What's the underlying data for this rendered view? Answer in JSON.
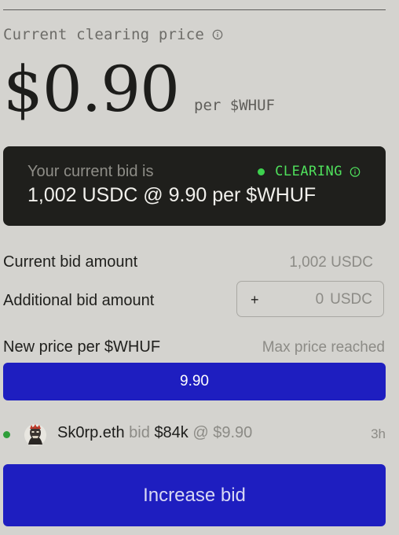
{
  "header": {
    "clearing_price_label": "Current clearing price",
    "clearing_price_value": "$0.90",
    "clearing_price_unit": "per $WHUF"
  },
  "current_bid_card": {
    "label": "Your current bid is",
    "value": "1,002 USDC @ 9.90 per $WHUF",
    "status": "CLEARING",
    "status_color": "#4fe05c"
  },
  "form": {
    "current_bid_label": "Current bid amount",
    "current_bid_value": "1,002 USDC",
    "additional_bid_label": "Additional bid amount",
    "additional_bid_prefix": "+",
    "additional_bid_value": "0",
    "additional_bid_currency": "USDC",
    "new_price_label": "New price per $WHUF",
    "new_price_note": "Max price reached",
    "new_price_value": "9.90"
  },
  "activity": {
    "user": "Sk0rp.eth",
    "verb": "bid",
    "amount": "$84k",
    "at": "@",
    "price": "$9.90",
    "time": "3h"
  },
  "cta": {
    "label": "Increase bid",
    "color": "#1e1ec0"
  },
  "icons": [
    "info-icon",
    "live-status-dot",
    "user-avatar"
  ]
}
